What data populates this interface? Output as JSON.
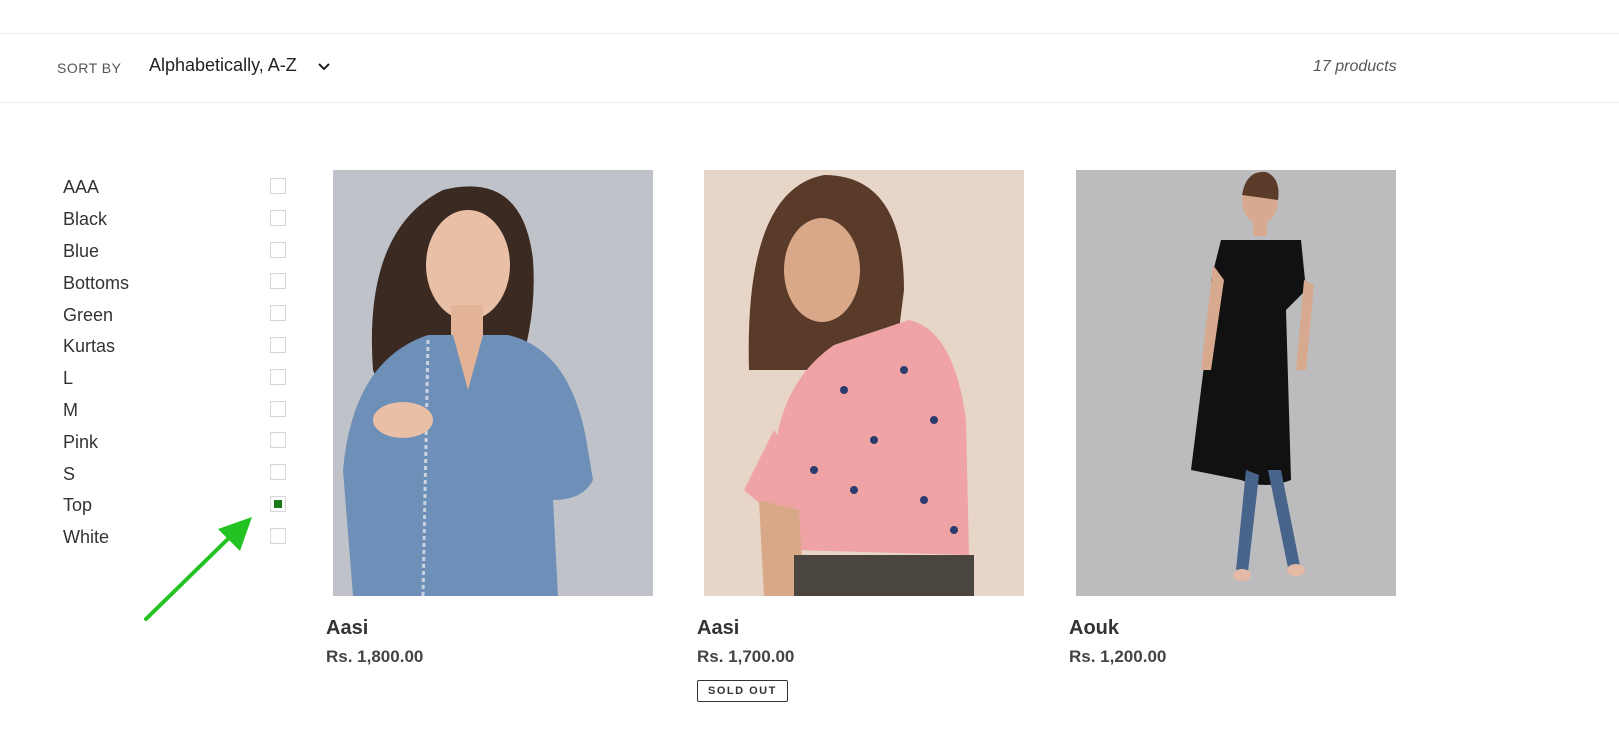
{
  "sort": {
    "label": "SORT BY",
    "selected": "Alphabetically, A-Z",
    "count": "17 products"
  },
  "filters": [
    {
      "label": "AAA",
      "checked": false
    },
    {
      "label": "Black",
      "checked": false
    },
    {
      "label": "Blue",
      "checked": false
    },
    {
      "label": "Bottoms",
      "checked": false
    },
    {
      "label": "Green",
      "checked": false
    },
    {
      "label": "Kurtas",
      "checked": false
    },
    {
      "label": "L",
      "checked": false
    },
    {
      "label": "M",
      "checked": false
    },
    {
      "label": "Pink",
      "checked": false
    },
    {
      "label": "S",
      "checked": false
    },
    {
      "label": "Top",
      "checked": true
    },
    {
      "label": "White",
      "checked": false
    }
  ],
  "products": [
    {
      "title": "Aasi",
      "price": "Rs. 1,800.00",
      "badge": ""
    },
    {
      "title": "Aasi",
      "price": "Rs. 1,700.00",
      "badge": "SOLD OUT"
    },
    {
      "title": "Aouk",
      "price": "Rs. 1,200.00",
      "badge": ""
    }
  ],
  "colors": {
    "checked_filter": "#1a7a1a",
    "annotation_arrow": "#22c322"
  }
}
